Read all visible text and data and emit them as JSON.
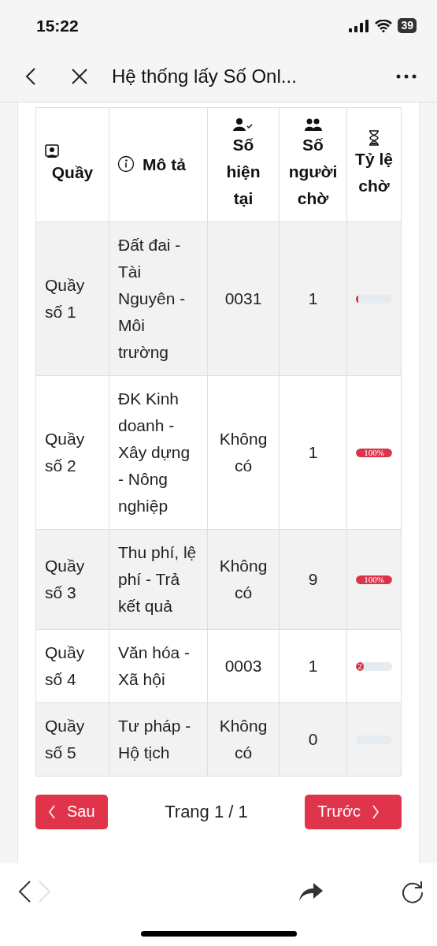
{
  "status_bar": {
    "time": "15:22",
    "battery": "39"
  },
  "nav": {
    "title": "Hệ thống lấy Số Onl..."
  },
  "table": {
    "columns": [
      {
        "label": "Quầy"
      },
      {
        "label": "Mô tả"
      },
      {
        "label": "Số hiện tại"
      },
      {
        "label": "Số người chờ"
      },
      {
        "label": "Tỷ lệ chờ"
      }
    ],
    "rows": [
      {
        "counter": "Quầy số 1",
        "description": "Đất đai - Tài Nguyên - Môi trường",
        "current": "0031",
        "waiting": "1",
        "rate": {
          "level": 0.04
        }
      },
      {
        "counter": "Quầy số 2",
        "description": "ĐK Kinh doanh - Xây dựng - Nông nghiệp",
        "current": "Không có",
        "waiting": "1",
        "rate": {
          "level": 1,
          "label": "100%"
        }
      },
      {
        "counter": "Quầy số 3",
        "description": "Thu phí, lệ phí - Trả kết quả",
        "current": "Không có",
        "waiting": "9",
        "rate": {
          "level": 1,
          "label": "100%"
        }
      },
      {
        "counter": "Quầy số 4",
        "description": "Văn hóa - Xã hội",
        "current": "0003",
        "waiting": "1",
        "rate": {
          "level": 0.22,
          "label": "2"
        }
      },
      {
        "counter": "Quầy số 5",
        "description": "Tư pháp - Hộ tịch",
        "current": "Không có",
        "waiting": "0",
        "rate": {}
      }
    ]
  },
  "pagination": {
    "prev": "Sau",
    "page": "Trang 1 / 1",
    "next": "Trước"
  }
}
